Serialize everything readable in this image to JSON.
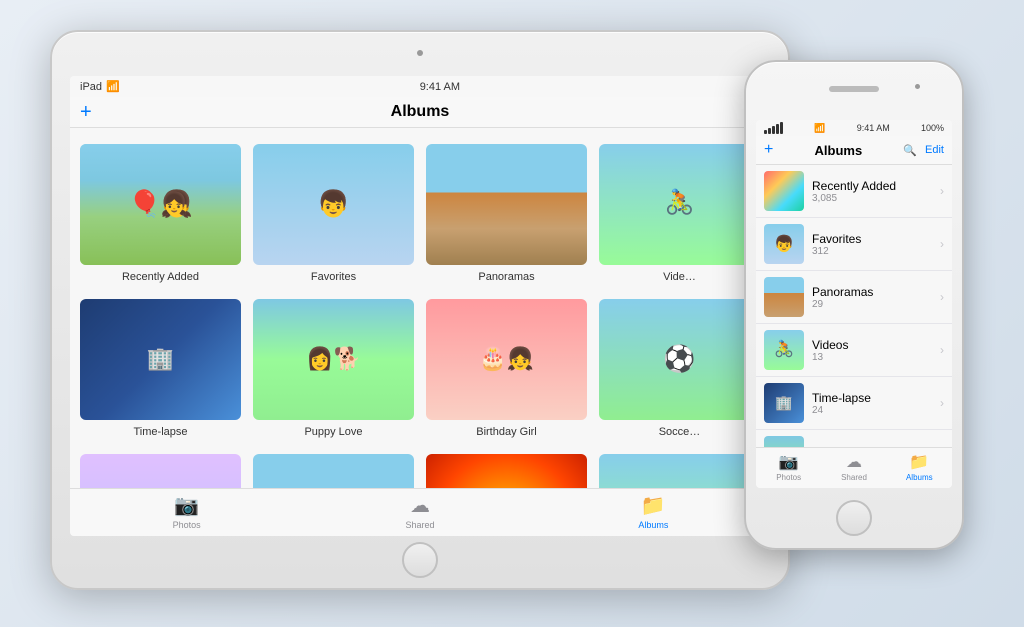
{
  "tablet": {
    "status": {
      "carrier": "iPad",
      "wifi": "wifi",
      "time": "9:41 AM"
    },
    "nav": {
      "plus": "+",
      "title": "Albums"
    },
    "albums": [
      {
        "id": "recently-added",
        "label": "Recently Added",
        "thumb": "girl-balloons"
      },
      {
        "id": "favorites",
        "label": "Favorites",
        "thumb": "boy-portrait"
      },
      {
        "id": "panoramas",
        "label": "Panoramas",
        "thumb": "panorama-scene"
      },
      {
        "id": "videos",
        "label": "Videos",
        "thumb": "cyclist"
      },
      {
        "id": "timelapse",
        "label": "Time-lapse",
        "thumb": "building-glass"
      },
      {
        "id": "puppy-love",
        "label": "Puppy Love",
        "thumb": "puppy-girl"
      },
      {
        "id": "birthday-girl",
        "label": "Birthday Girl",
        "thumb": "birthday-girl"
      },
      {
        "id": "soccer",
        "label": "Soccer",
        "thumb": "soccer-field"
      },
      {
        "id": "selfie",
        "label": "",
        "thumb": "selfie-group"
      },
      {
        "id": "landscape",
        "label": "",
        "thumb": "mountain-scene"
      },
      {
        "id": "flower",
        "label": "",
        "thumb": "flower-macro"
      },
      {
        "id": "family",
        "label": "",
        "thumb": "family-photo"
      }
    ],
    "tabs": [
      {
        "id": "photos",
        "label": "Photos",
        "icon": "📷",
        "active": false
      },
      {
        "id": "shared",
        "label": "Shared",
        "icon": "☁",
        "active": false
      },
      {
        "id": "albums",
        "label": "Albums",
        "icon": "📁",
        "active": true
      }
    ]
  },
  "phone": {
    "status": {
      "signal": "•••••",
      "wifi": "wifi",
      "time": "9:41 AM",
      "battery": "100%"
    },
    "nav": {
      "plus": "+",
      "title": "Albums",
      "search": "🔍",
      "edit": "Edit"
    },
    "albums": [
      {
        "id": "recently-added",
        "name": "Recently Added",
        "count": "3,085",
        "thumb": "pt-recently"
      },
      {
        "id": "favorites",
        "name": "Favorites",
        "count": "312",
        "thumb": "pt-favorites"
      },
      {
        "id": "panoramas",
        "name": "Panoramas",
        "count": "29",
        "thumb": "pt-panoramas"
      },
      {
        "id": "videos",
        "name": "Videos",
        "count": "13",
        "thumb": "pt-videos"
      },
      {
        "id": "timelapse",
        "name": "Time-lapse",
        "count": "24",
        "thumb": "pt-timelapse"
      },
      {
        "id": "puppy",
        "name": "",
        "count": "",
        "thumb": "pt-puppy"
      }
    ],
    "tabs": [
      {
        "id": "photos",
        "label": "Photos",
        "icon": "📷",
        "active": false
      },
      {
        "id": "shared",
        "label": "Shared",
        "icon": "☁",
        "active": false
      },
      {
        "id": "albums",
        "label": "Albums",
        "icon": "📁",
        "active": true
      }
    ]
  }
}
